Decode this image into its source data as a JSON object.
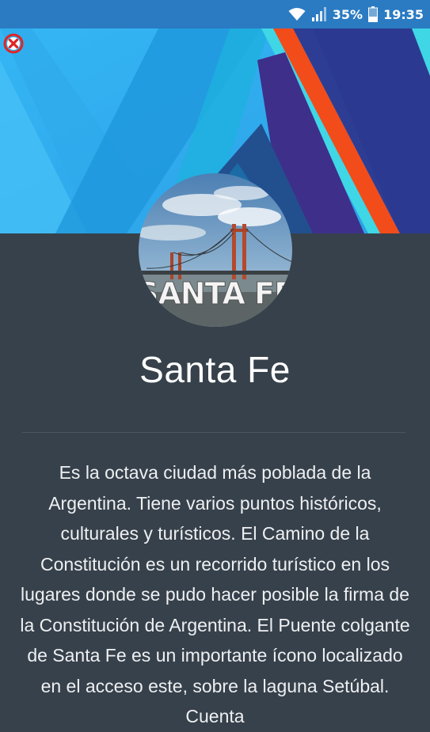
{
  "status_bar": {
    "battery_percent": "35%",
    "time": "19:35",
    "icons": [
      "wifi-icon",
      "signal-icon",
      "battery-icon"
    ]
  },
  "banner": {
    "colors": {
      "light_blue": "#34b4f2",
      "mid_blue": "#1f96dc",
      "navy": "#2d3d94",
      "indigo": "#3e2f8a",
      "orange": "#f24c1a",
      "cyan": "#3fd6e6"
    }
  },
  "close_button": {
    "icon": "close-icon",
    "color": "#e02424"
  },
  "avatar": {
    "image_text": "SANTA FE"
  },
  "city": {
    "name": "Santa Fe",
    "description": "Es la octava ciudad más poblada de la Argentina. Tiene varios puntos históricos, culturales y turísticos. El Camino de la Constitución es un recorrido turístico en los lugares donde se pudo hacer posible la firma de la Constitución de Argentina. El Puente colgante de Santa Fe es un importante ícono localizado en el acceso este, sobre la laguna Setúbal. Cuenta"
  },
  "colors": {
    "status_bar": "#2a7bc2",
    "background": "#37414b",
    "text": "#ffffff"
  }
}
